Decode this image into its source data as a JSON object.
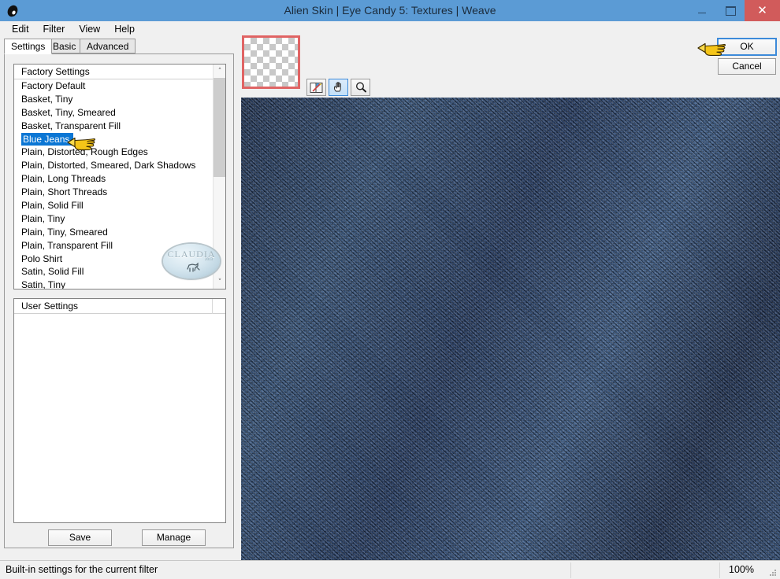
{
  "window": {
    "title": "Alien Skin | Eye Candy 5: Textures | Weave",
    "app_icon": "alien-eye-icon",
    "controls": {
      "minimize": "–",
      "maximize": "□",
      "close": "✕"
    },
    "accent_title_bg": "#5b9bd5",
    "close_bg": "#d15b5b"
  },
  "menubar": {
    "items": [
      "Edit",
      "Filter",
      "View",
      "Help"
    ]
  },
  "tabs": [
    {
      "label": "Settings",
      "active": true
    },
    {
      "label": "Basic",
      "active": false
    },
    {
      "label": "Advanced",
      "active": false
    }
  ],
  "factory": {
    "header": "Factory Settings",
    "selected": "Blue Jeans",
    "items": [
      "Factory Default",
      "Basket, Tiny",
      "Basket, Tiny, Smeared",
      "Basket, Transparent Fill",
      "Blue Jeans",
      "Plain, Distorted, Rough Edges",
      "Plain, Distorted, Smeared, Dark Shadows",
      "Plain, Long Threads",
      "Plain, Short Threads",
      "Plain, Solid Fill",
      "Plain, Tiny",
      "Plain, Tiny, Smeared",
      "Plain, Transparent Fill",
      "Polo Shirt",
      "Satin, Solid Fill",
      "Satin, Tiny"
    ],
    "selection_color": "#0b76d4",
    "scroll_up_glyph": "˄",
    "scroll_down_glyph": "˅"
  },
  "watermark": {
    "text": "CLAUDIA",
    "subtext": "2013",
    "figure": "dog-figure"
  },
  "user_settings": {
    "header": "User Settings",
    "items": []
  },
  "left_buttons": {
    "save": "Save",
    "manage": "Manage"
  },
  "preview_tools": [
    {
      "name": "compare-preview-tool",
      "active": false
    },
    {
      "name": "hand-pan-tool",
      "active": true
    },
    {
      "name": "zoom-magnifier-tool",
      "active": false
    }
  ],
  "thumbnail": {
    "border_color": "#e06464",
    "content": "transparent-checkerboard"
  },
  "preview": {
    "texture": "blue-denim-weave",
    "base_color": "#2e4a73",
    "dark_color": "#1b2c4a",
    "light_color": "#4d6e9b"
  },
  "dialog_buttons": {
    "ok": "OK",
    "cancel": "Cancel",
    "focus_color": "#3c8ad9"
  },
  "annotations": [
    {
      "name": "hand-pointer-list",
      "points_to": "Blue Jeans"
    },
    {
      "name": "hand-pointer-ok",
      "points_to": "OK"
    }
  ],
  "statusbar": {
    "message": "Built-in settings for the current filter",
    "zoom": "100%"
  }
}
